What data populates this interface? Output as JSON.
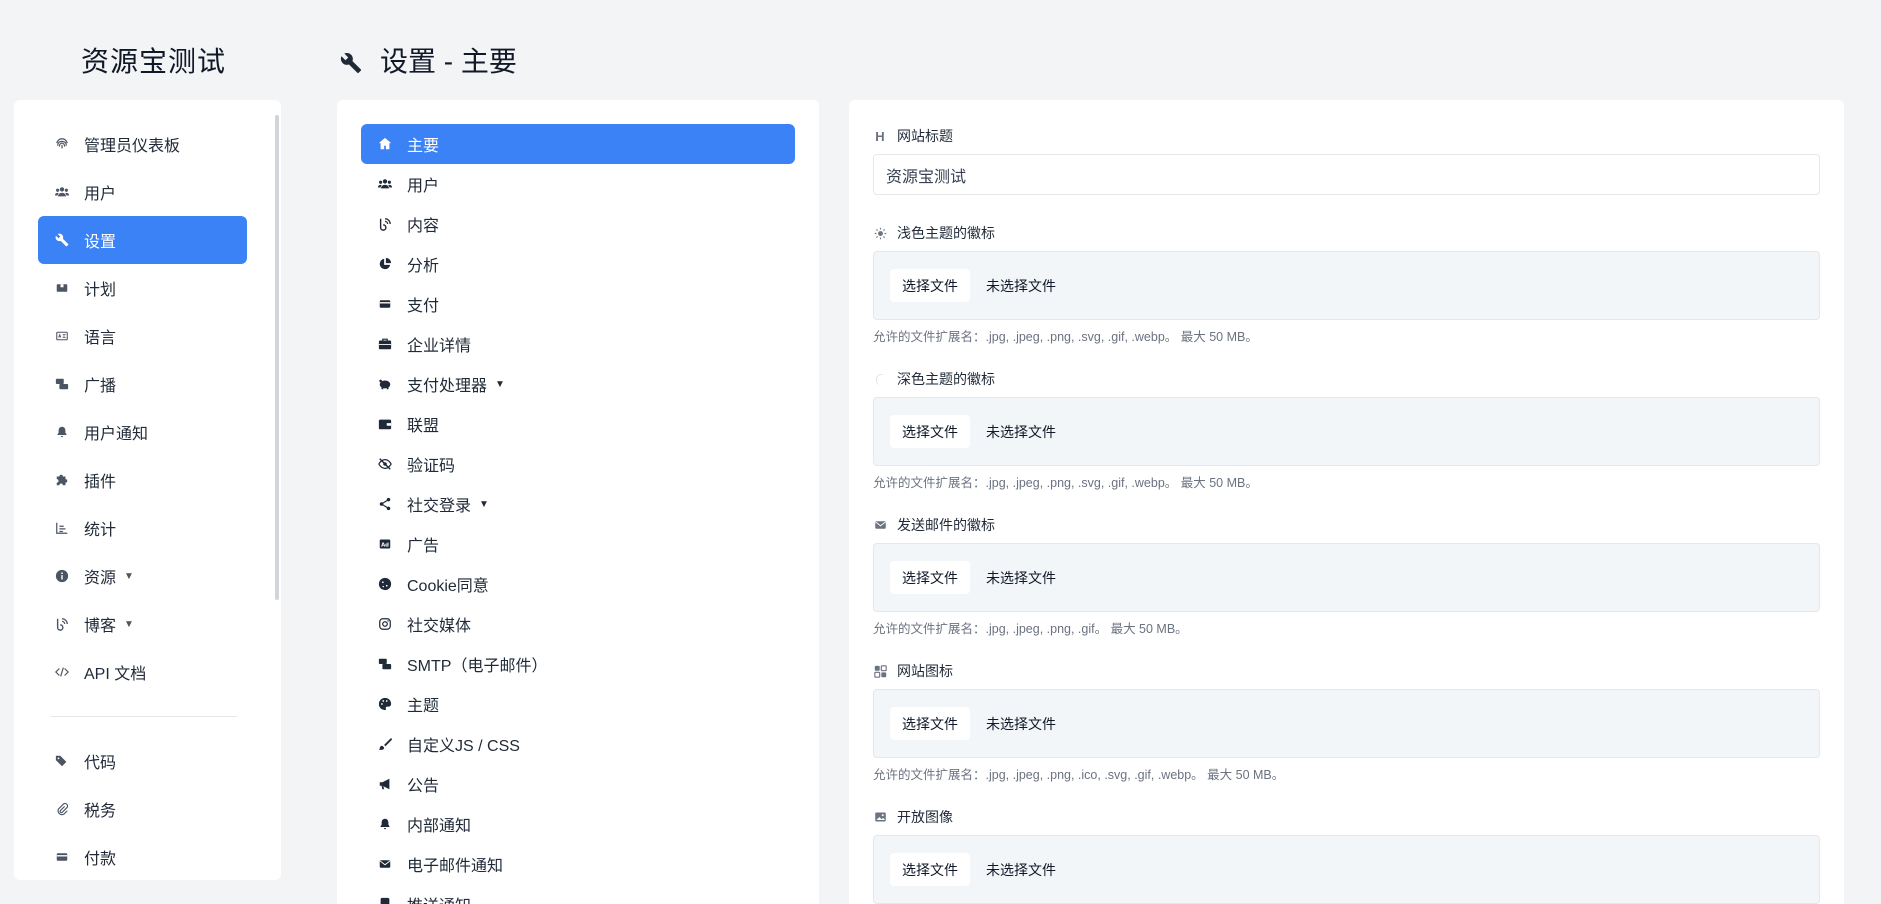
{
  "app": {
    "brand": "资源宝测试"
  },
  "page": {
    "title": "设置 - 主要"
  },
  "sidebar": {
    "items": [
      {
        "label": "管理员仪表板",
        "icon": "fingerprint-icon"
      },
      {
        "label": "用户",
        "icon": "users-icon"
      },
      {
        "label": "设置",
        "icon": "wrench-icon",
        "active": true
      },
      {
        "label": "计划",
        "icon": "box-icon"
      },
      {
        "label": "语言",
        "icon": "language-card-icon"
      },
      {
        "label": "广播",
        "icon": "broadcast-icon"
      },
      {
        "label": "用户通知",
        "icon": "bell-icon"
      },
      {
        "label": "插件",
        "icon": "puzzle-icon"
      },
      {
        "label": "统计",
        "icon": "chart-icon"
      },
      {
        "label": "资源",
        "icon": "info-icon",
        "caret": "▼"
      },
      {
        "label": "博客",
        "icon": "blog-icon",
        "caret": "▼"
      },
      {
        "label": "API 文档",
        "icon": "code-icon"
      }
    ],
    "bottom_items": [
      {
        "label": "代码",
        "icon": "tags-icon"
      },
      {
        "label": "税务",
        "icon": "paperclip-icon"
      },
      {
        "label": "付款",
        "icon": "credit-card-icon"
      }
    ]
  },
  "settings_menu": {
    "items": [
      {
        "label": "主要",
        "icon": "home-icon",
        "active": true
      },
      {
        "label": "用户",
        "icon": "users-icon"
      },
      {
        "label": "内容",
        "icon": "blog-icon"
      },
      {
        "label": "分析",
        "icon": "pie-chart-icon"
      },
      {
        "label": "支付",
        "icon": "credit-card-icon"
      },
      {
        "label": "企业详情",
        "icon": "briefcase-icon"
      },
      {
        "label": "支付处理器",
        "icon": "piggy-bank-icon",
        "caret": "▼"
      },
      {
        "label": "联盟",
        "icon": "wallet-icon"
      },
      {
        "label": "验证码",
        "icon": "eye-slash-icon"
      },
      {
        "label": "社交登录",
        "icon": "share-icon",
        "caret": "▼"
      },
      {
        "label": "广告",
        "icon": "ad-icon"
      },
      {
        "label": "Cookie同意",
        "icon": "cookie-icon"
      },
      {
        "label": "社交媒体",
        "icon": "instagram-icon"
      },
      {
        "label": "SMTP（电子邮件）",
        "icon": "mail-bulk-icon"
      },
      {
        "label": "主题",
        "icon": "palette-icon"
      },
      {
        "label": "自定义JS / CSS",
        "icon": "brush-icon"
      },
      {
        "label": "公告",
        "icon": "bullhorn-icon"
      },
      {
        "label": "内部通知",
        "icon": "bell-icon"
      },
      {
        "label": "电子邮件通知",
        "icon": "envelope-icon"
      },
      {
        "label": "推送通知",
        "icon": "push-icon"
      }
    ]
  },
  "form": {
    "title_field": {
      "label": "网站标题",
      "icon": "heading-icon",
      "value": "资源宝测试"
    },
    "file_fields": [
      {
        "label": "浅色主题的徽标",
        "icon": "sun-icon",
        "button": "选择文件",
        "status": "未选择文件",
        "help": "允许的文件扩展名：.jpg, .jpeg, .png, .svg, .gif, .webp。 最大 50 MB。"
      },
      {
        "label": "深色主题的徽标",
        "icon": "moon-icon",
        "button": "选择文件",
        "status": "未选择文件",
        "help": "允许的文件扩展名：.jpg, .jpeg, .png, .svg, .gif, .webp。 最大 50 MB。"
      },
      {
        "label": "发送邮件的徽标",
        "icon": "envelope-icon",
        "button": "选择文件",
        "status": "未选择文件",
        "help": "允许的文件扩展名：.jpg, .jpeg, .png, .gif。 最大 50 MB。"
      },
      {
        "label": "网站图标",
        "icon": "favicon-icon",
        "button": "选择文件",
        "status": "未选择文件",
        "help": "允许的文件扩展名：.jpg, .jpeg, .png, .ico, .svg, .gif, .webp。 最大 50 MB。"
      },
      {
        "label": "开放图像",
        "icon": "image-icon",
        "button": "选择文件",
        "status": "未选择文件",
        "help": ""
      }
    ]
  },
  "colors": {
    "accent": "#3b82f6",
    "background": "#f3f4f6"
  }
}
